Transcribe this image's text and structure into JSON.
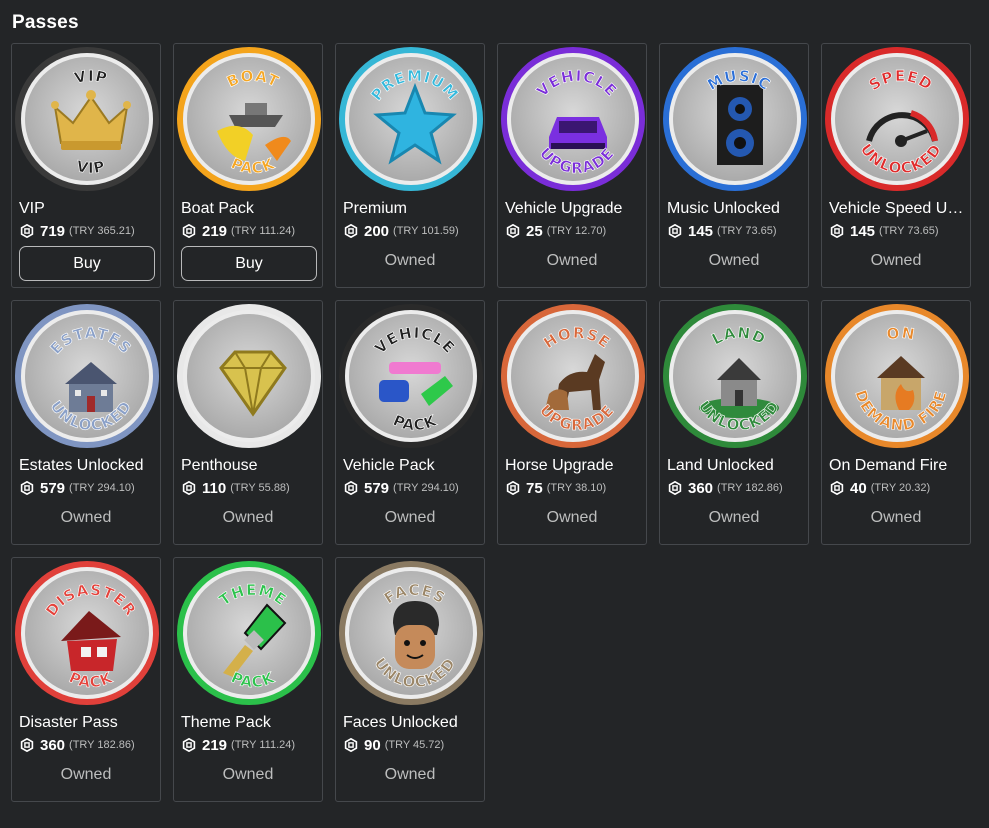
{
  "section": {
    "title": "Passes"
  },
  "passes": [
    {
      "name": "VIP",
      "price": "719",
      "local_price": "(TRY 365.21)",
      "status": "buy",
      "button_label": "Buy",
      "owned_label": "",
      "badge": {
        "top": "VIP",
        "bottom": "VIP",
        "ring_color": "#3a3a3a",
        "text_color": "#1f1f1f",
        "icon": "crown-icon",
        "icon_color": "#e0b54a"
      }
    },
    {
      "name": "Boat Pack",
      "price": "219",
      "local_price": "(TRY 111.24)",
      "status": "buy",
      "button_label": "Buy",
      "owned_label": "",
      "badge": {
        "top": "BOAT",
        "bottom": "PACK",
        "ring_color": "#f4a41c",
        "text_color": "#f5a623",
        "icon": "boat-icon",
        "icon_color": "#f2d026"
      }
    },
    {
      "name": "Premium",
      "price": "200",
      "local_price": "(TRY 101.59)",
      "status": "owned",
      "button_label": "",
      "owned_label": "Owned",
      "badge": {
        "top": "PREMIUM",
        "bottom": "",
        "ring_color": "#36b7d6",
        "text_color": "#35b9dc",
        "icon": "star-icon",
        "icon_color": "#2fb4e0"
      }
    },
    {
      "name": "Vehicle Upgrade",
      "price": "25",
      "local_price": "(TRY 12.70)",
      "status": "owned",
      "button_label": "",
      "owned_label": "Owned",
      "badge": {
        "top": "VEHICLE",
        "bottom": "UPGRADE",
        "ring_color": "#7a2dd8",
        "text_color": "#7b2fd9",
        "icon": "car-icon",
        "icon_color": "#7a2fe0"
      }
    },
    {
      "name": "Music Unlocked",
      "price": "145",
      "local_price": "(TRY 73.65)",
      "status": "owned",
      "button_label": "",
      "owned_label": "Owned",
      "badge": {
        "top": "MUSIC",
        "bottom": "",
        "ring_color": "#2a6fd6",
        "text_color": "#2b6fd8",
        "icon": "speaker-icon",
        "icon_color": "#1d1d1d"
      }
    },
    {
      "name": "Vehicle Speed Unlocked",
      "price": "145",
      "local_price": "(TRY 73.65)",
      "status": "owned",
      "button_label": "",
      "owned_label": "Owned",
      "badge": {
        "top": "SPEED",
        "bottom": "UNLOCKED",
        "ring_color": "#d92a2a",
        "text_color": "#e02b2b",
        "icon": "speedometer-icon",
        "icon_color": "#222222"
      }
    },
    {
      "name": "Estates Unlocked",
      "price": "579",
      "local_price": "(TRY 294.10)",
      "status": "owned",
      "button_label": "",
      "owned_label": "Owned",
      "badge": {
        "top": "ESTATES",
        "bottom": "UNLOCKED",
        "ring_color": "#7f95c2",
        "text_color": "#8aa0c8",
        "icon": "mansion-icon",
        "icon_color": "#6e7c96"
      }
    },
    {
      "name": "Penthouse",
      "price": "110",
      "local_price": "(TRY 55.88)",
      "status": "owned",
      "button_label": "",
      "owned_label": "Owned",
      "badge": {
        "top": "",
        "bottom": "",
        "ring_color": "#e8e8e8",
        "text_color": "#c9b548",
        "icon": "diamond-icon",
        "icon_color": "#d8c24e"
      }
    },
    {
      "name": "Vehicle Pack",
      "price": "579",
      "local_price": "(TRY 294.10)",
      "status": "owned",
      "button_label": "",
      "owned_label": "Owned",
      "badge": {
        "top": "VEHICLE",
        "bottom": "PACK",
        "ring_color": "#2a2a2a",
        "text_color": "#1f1f1f",
        "icon": "cars-icon",
        "icon_color": "#2ec94a"
      }
    },
    {
      "name": "Horse Upgrade",
      "price": "75",
      "local_price": "(TRY 38.10)",
      "status": "owned",
      "button_label": "",
      "owned_label": "Owned",
      "badge": {
        "top": "HORSE",
        "bottom": "UPGRADE",
        "ring_color": "#d8673a",
        "text_color": "#d8683b",
        "icon": "horse-icon",
        "icon_color": "#5a3a22"
      }
    },
    {
      "name": "Land Unlocked",
      "price": "360",
      "local_price": "(TRY 182.86)",
      "status": "owned",
      "button_label": "",
      "owned_label": "Owned",
      "badge": {
        "top": "LAND",
        "bottom": "UNLOCKED",
        "ring_color": "#2e8a3a",
        "text_color": "#2f8a3c",
        "icon": "house-land-icon",
        "icon_color": "#4d4d4d"
      }
    },
    {
      "name": "On Demand Fire",
      "price": "40",
      "local_price": "(TRY 20.32)",
      "status": "owned",
      "button_label": "",
      "owned_label": "Owned",
      "badge": {
        "top": "ON",
        "bottom": "DEMAND FIRE",
        "ring_color": "#e8882a",
        "text_color": "#e8892c",
        "icon": "burning-house-icon",
        "icon_color": "#e67b22"
      }
    },
    {
      "name": "Disaster Pass",
      "price": "360",
      "local_price": "(TRY 182.86)",
      "status": "owned",
      "button_label": "",
      "owned_label": "Owned",
      "badge": {
        "top": "DISASTER",
        "bottom": "PACK",
        "ring_color": "#e0403a",
        "text_color": "#e4423b",
        "icon": "broken-house-icon",
        "icon_color": "#c8262a"
      }
    },
    {
      "name": "Theme Pack",
      "price": "219",
      "local_price": "(TRY 111.24)",
      "status": "owned",
      "button_label": "",
      "owned_label": "Owned",
      "badge": {
        "top": "THEME",
        "bottom": "PACK",
        "ring_color": "#2bc04a",
        "text_color": "#2cc24c",
        "icon": "paintbrush-icon",
        "icon_color": "#d4b04a"
      }
    },
    {
      "name": "Faces Unlocked",
      "price": "90",
      "local_price": "(TRY 45.72)",
      "status": "owned",
      "button_label": "",
      "owned_label": "Owned",
      "badge": {
        "top": "FACES",
        "bottom": "UNLOCKED",
        "ring_color": "#8a7a62",
        "text_color": "#9a8566",
        "icon": "face-icon",
        "icon_color": "#2a2a2a"
      }
    }
  ],
  "colors": {
    "background": "#232527",
    "card_border": "#45484c",
    "text_primary": "#ffffff",
    "text_secondary": "#bdbebe"
  }
}
